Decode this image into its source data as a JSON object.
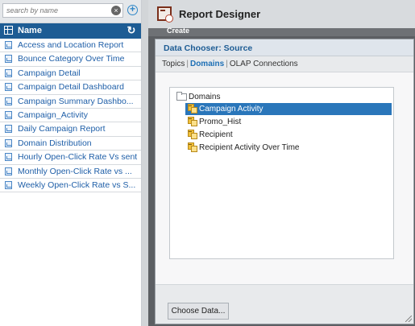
{
  "search": {
    "placeholder": "search by name"
  },
  "list": {
    "header": "Name",
    "items": [
      "Access and Location Report",
      "Bounce Category Over Time",
      "Campaign Detail",
      "Campaign Detail Dashboard",
      "Campaign Summary Dashbo...",
      "Campaign_Activity",
      "Daily Campaign Report",
      "Domain Distribution",
      "Hourly Open-Click Rate Vs sent",
      "Monthly Open-Click Rate vs ...",
      "Weekly Open-Click Rate vs S..."
    ]
  },
  "designer": {
    "title": "Report Designer",
    "create_label": "Create"
  },
  "dialog": {
    "title": "Data Chooser: Source",
    "tabs": [
      "Topics",
      "Domains",
      "OLAP Connections"
    ],
    "active_tab": "Domains",
    "tree": {
      "root": "Domains",
      "children": [
        "Campaign Activity",
        "Promo_Hist",
        "Recipient",
        "Recipient Activity Over Time"
      ],
      "selected": "Campaign Activity"
    },
    "button_label": "Choose Data..."
  },
  "colors": {
    "accent": "#1d5c94",
    "link": "#1f5fa8",
    "selection": "#2a76ba"
  }
}
